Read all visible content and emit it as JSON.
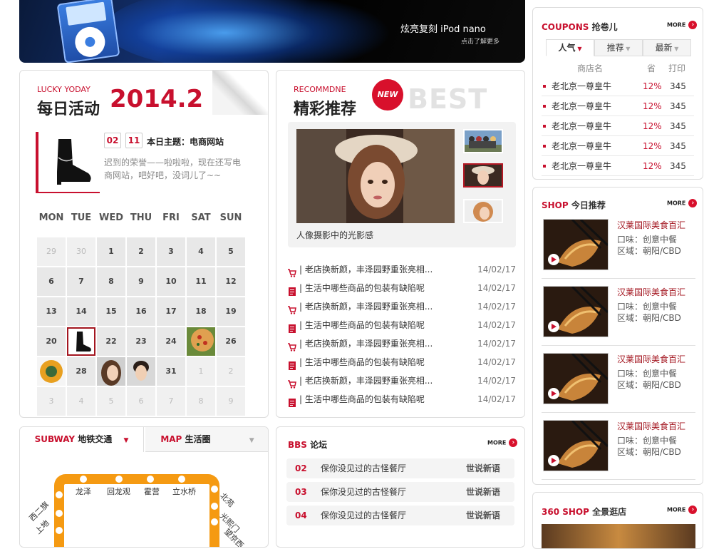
{
  "banner": {
    "slogan": "炫亮复刻  iPod nano",
    "sub": "点击了解更多"
  },
  "lucky": {
    "en": "LUCKY YODAY",
    "cn": "每日活动",
    "year": "2014.2",
    "month": "02",
    "day": "11",
    "theme_label": "本日主题：电商网站",
    "theme_text": "迟到的荣誉——啦啦啦，现在还写电商网站，吧好吧，没词儿了~~",
    "weekdays": [
      "MON",
      "TUE",
      "WED",
      "THU",
      "FRI",
      "SAT",
      "SUN"
    ],
    "days": [
      [
        "29",
        "30",
        "1",
        "2",
        "3",
        "4",
        "5"
      ],
      [
        "6",
        "7",
        "8",
        "9",
        "10",
        "11",
        "12"
      ],
      [
        "13",
        "14",
        "15",
        "16",
        "17",
        "18",
        "19"
      ],
      [
        "20",
        "",
        "22",
        "23",
        "24",
        "",
        "26"
      ],
      [
        "",
        "28",
        "",
        "",
        "31",
        "1",
        "2"
      ],
      [
        "3",
        "4",
        "5",
        "6",
        "7",
        "8",
        "9"
      ]
    ]
  },
  "recommend": {
    "en": "RECOMMDNE",
    "cn": "精彩推荐",
    "badge": "NEW",
    "best": "BEST",
    "caption": "人像摄影中的光影感",
    "news": [
      {
        "t": "老店换新颜，丰泽园野重张亮相...",
        "d": "14/02/17",
        "icon": "cart"
      },
      {
        "t": "生活中哪些商品的包装有缺陷呢",
        "d": "14/02/17",
        "icon": "doc"
      },
      {
        "t": "老店换新颜，丰泽园野重张亮相...",
        "d": "14/02/17",
        "icon": "cart"
      },
      {
        "t": "生活中哪些商品的包装有缺陷呢",
        "d": "14/02/17",
        "icon": "doc"
      },
      {
        "t": "老店换新颜，丰泽园野重张亮相...",
        "d": "14/02/17",
        "icon": "cart"
      },
      {
        "t": "生活中哪些商品的包装有缺陷呢",
        "d": "14/02/17",
        "icon": "doc"
      },
      {
        "t": "老店换新颜，丰泽园野重张亮相...",
        "d": "14/02/17",
        "icon": "cart"
      },
      {
        "t": "生活中哪些商品的包装有缺陷呢",
        "d": "14/02/17",
        "icon": "doc"
      }
    ]
  },
  "subway": {
    "tab1_en": "SUBWAY",
    "tab1_cn": "地铁交通",
    "tab2_en": "MAP",
    "tab2_cn": "生活圈",
    "stations_top": [
      "龙泽",
      "回龙观",
      "霍营",
      "立水桥"
    ],
    "station_left1": "西二旗",
    "station_left2": "上地",
    "station_right1": "北苑",
    "station_right2": "望京西",
    "station_right3": "光熙门"
  },
  "bbs": {
    "en": "BBS",
    "cn": "论坛",
    "more": "MORE",
    "rows": [
      {
        "n": "02",
        "t": "保你没见过的古怪餐厅",
        "c": "世说新语"
      },
      {
        "n": "03",
        "t": "保你没见过的古怪餐厅",
        "c": "世说新语"
      },
      {
        "n": "04",
        "t": "保你没见过的古怪餐厅",
        "c": "世说新语"
      }
    ]
  },
  "coupons": {
    "en": "COUPONS",
    "cn": "抢卷儿",
    "more": "MORE",
    "tabs": [
      "人气",
      "推荐",
      "最新"
    ],
    "headers": [
      "商店名",
      "省",
      "打印"
    ],
    "rows": [
      {
        "n": "老北京一尊皇牛",
        "p": "12%",
        "q": "345"
      },
      {
        "n": "老北京一尊皇牛",
        "p": "12%",
        "q": "345"
      },
      {
        "n": "老北京一尊皇牛",
        "p": "12%",
        "q": "345"
      },
      {
        "n": "老北京一尊皇牛",
        "p": "12%",
        "q": "345"
      },
      {
        "n": "老北京一尊皇牛",
        "p": "12%",
        "q": "345"
      }
    ]
  },
  "shop": {
    "en": "SHOP",
    "cn": "今日推荐",
    "more": "MORE",
    "items": [
      {
        "name": "汉莱国际美食百汇",
        "l1": "口味：创意中餐",
        "l2": "区域：朝阳/CBD"
      },
      {
        "name": "汉莱国际美食百汇",
        "l1": "口味：创意中餐",
        "l2": "区域：朝阳/CBD"
      },
      {
        "name": "汉莱国际美食百汇",
        "l1": "口味：创意中餐",
        "l2": "区域：朝阳/CBD"
      },
      {
        "name": "汉莱国际美食百汇",
        "l1": "口味：创意中餐",
        "l2": "区域：朝阳/CBD"
      }
    ]
  },
  "shop360": {
    "en": "360 SHOP",
    "cn": "全景逛店",
    "more": "MORE"
  }
}
